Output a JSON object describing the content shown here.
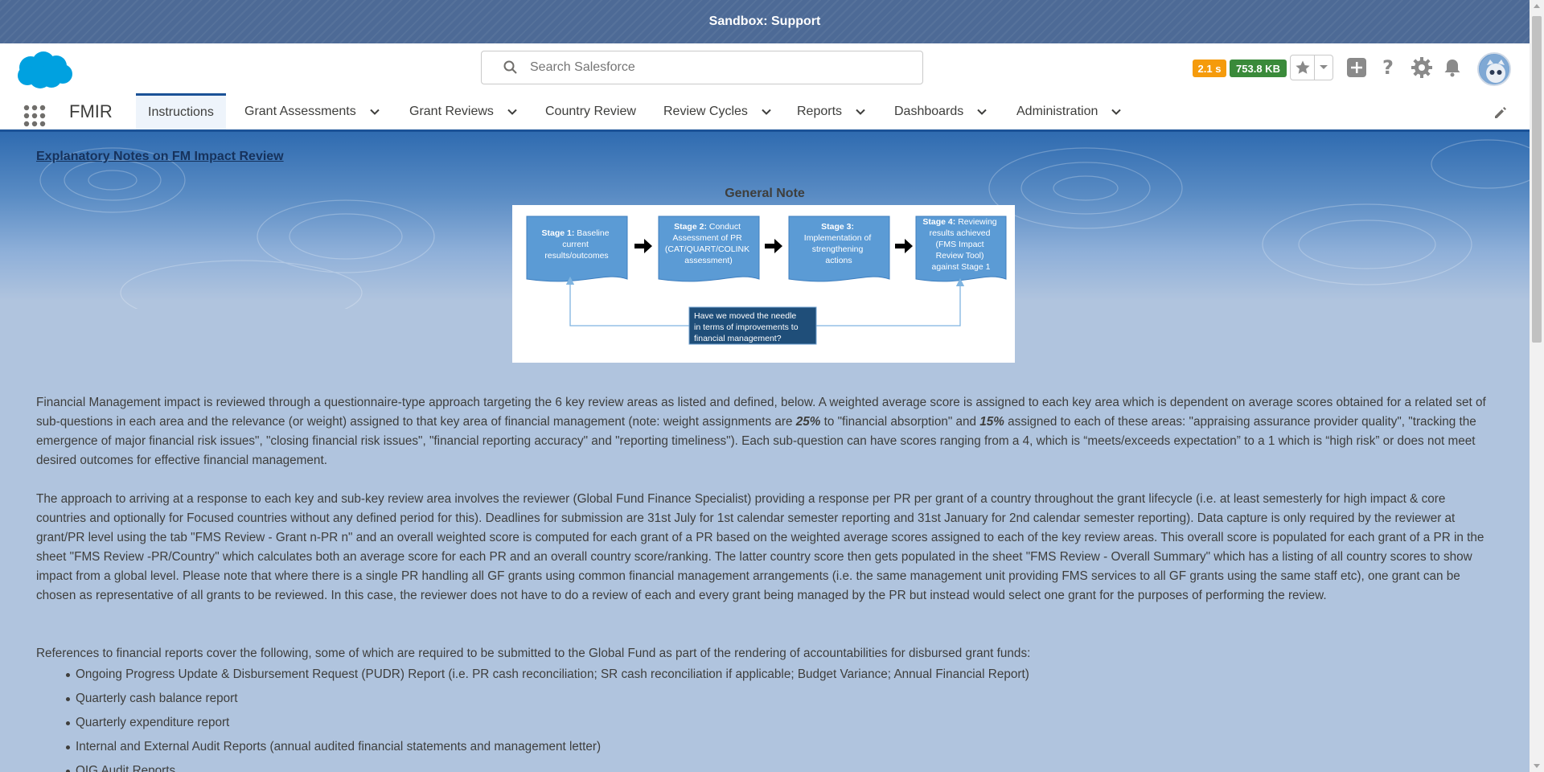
{
  "sandbox_banner": "Sandbox: Support",
  "search": {
    "placeholder": "Search Salesforce"
  },
  "perf": {
    "time": "2.1 s",
    "size": "753.8 KB"
  },
  "header_icons": [
    "favorite-star-icon",
    "favorites-list-icon",
    "global-add-icon",
    "help-icon",
    "setup-gear-icon",
    "notifications-bell-icon",
    "avatar"
  ],
  "nav": {
    "app_name": "FMIR",
    "tabs": [
      {
        "label": "Instructions",
        "active": true,
        "has_menu": false
      },
      {
        "label": "Grant Assessments",
        "has_menu": true
      },
      {
        "label": "Grant Reviews",
        "has_menu": true
      },
      {
        "label": "Country Review",
        "has_menu": false
      },
      {
        "label": "Review Cycles",
        "has_menu": true
      },
      {
        "label": "Reports",
        "has_menu": true
      },
      {
        "label": "Dashboards",
        "has_menu": true
      },
      {
        "label": "Administration",
        "has_menu": true
      }
    ]
  },
  "content": {
    "title": "Explanatory Notes on FM Impact Review",
    "general_note": "General Note",
    "diagram": {
      "stages": [
        {
          "bold": "Stage 1:",
          "lines": [
            "Baseline",
            "current",
            "results/outcomes"
          ]
        },
        {
          "bold": "Stage 2:",
          "lines": [
            "Conduct",
            "Assessment of PR",
            "(CAT/QUART/COLINK",
            "assessment)"
          ]
        },
        {
          "bold": "Stage 3:",
          "lines": [
            "Implementation of",
            "strengthening",
            "actions"
          ]
        },
        {
          "bold": "Stage 4:",
          "lines": [
            "Reviewing",
            "results achieved",
            "(FMS Impact",
            "Review Tool)",
            "against Stage 1"
          ]
        }
      ],
      "question_lines": [
        "Have we moved the needle",
        "in terms of improvements to",
        "financial management?"
      ]
    },
    "para1": {
      "a": "Financial Management impact is reviewed through a questionnaire-type approach targeting the 6 key review areas as listed and defined, below. A weighted average score is assigned to each key area which is dependent on average scores obtained for a related set of sub-questions in each area and the relevance (or weight) assigned to that key area of financial management (note: weight assignments are ",
      "w1": "25%",
      "b": " to \"financial absorption\" and ",
      "w2": "15%",
      "c": " assigned to each of these areas: \"appraising assurance provider quality\", \"tracking the emergence of major financial risk issues\", \"closing financial risk issues\", \"financial reporting accuracy\" and \"reporting timeliness\"). Each sub-question can have scores ranging from a 4, which is “meets/exceeds expectation” to a 1 which is “high risk” or does not meet desired outcomes for effective financial management."
    },
    "para2": "The approach to arriving at a response to each key and sub-key review area involves the reviewer (Global Fund Finance Specialist) providing a response per PR per grant of a country throughout the grant lifecycle (i.e. at least semesterly for high impact & core countries and optionally for Focused countries without any defined period for this). Deadlines for submission are 31st July for 1st calendar semester reporting and 31st January for 2nd calendar semester reporting). Data capture is only required by the reviewer at grant/PR level using the tab \"FMS Review - Grant n-PR n\" and an overall weighted score is computed for each grant of a PR based on the weighted average scores assigned to each of the key review areas. This overall score is populated for each grant of a PR in the sheet \"FMS Review -PR/Country\" which calculates both an average score for each PR and an overall country score/ranking. The latter country score then gets populated in the sheet \"FMS Review - Overall Summary\" which has a listing of all country scores to show impact from a global level. Please note that where there is a single PR handling all GF grants using common financial management arrangements (i.e. the same management unit providing FMS services to all GF grants using the same staff etc), one grant can be chosen as representative of all grants to be reviewed. In this case, the reviewer does not have to do a review of each and every grant being managed by the PR but instead would select one grant for the purposes of performing the review.",
    "para3": "References to financial reports cover the following, some of which are required to be submitted to the Global Fund as part of the rendering of accountabilities for disbursed grant funds:",
    "references": [
      "Ongoing Progress Update & Disbursement Request (PUDR) Report (i.e. PR cash reconciliation; SR cash reconciliation if applicable; Budget Variance; Annual Financial Report)",
      "Quarterly cash balance report",
      "Quarterly expenditure report",
      "Internal and External Audit Reports (annual audited financial statements and management letter)",
      "OIG Audit Reports"
    ]
  },
  "colors": {
    "brand_blue": "#1b5297",
    "sandbox_bar": "#4d6a96",
    "perf_time": "#f59b0c",
    "perf_size": "#3a8a3a",
    "stage_box": "#5b9bd5",
    "question_box": "#1f4e79"
  }
}
